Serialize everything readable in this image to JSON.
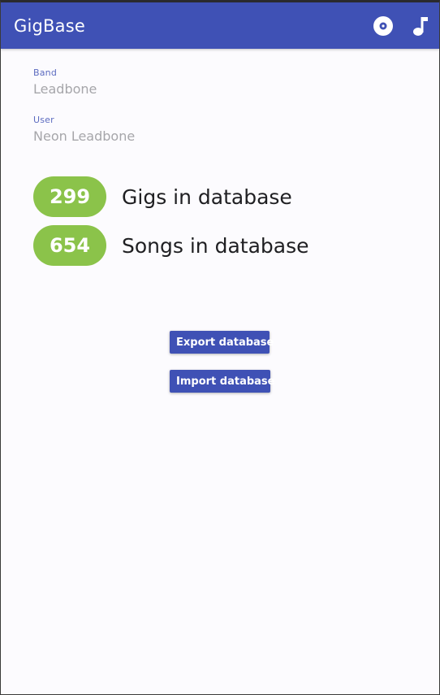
{
  "app": {
    "title": "GigBase"
  },
  "toolbar": {
    "actions": [
      {
        "icon": "disc-icon"
      },
      {
        "icon": "music-note-icon"
      }
    ]
  },
  "fields": {
    "band": {
      "label": "Band",
      "value": "Leadbone"
    },
    "user": {
      "label": "User",
      "value": "Neon Leadbone"
    }
  },
  "stats": {
    "gigs": {
      "count": "299",
      "label": "Gigs in database"
    },
    "songs": {
      "count": "654",
      "label": "Songs in database"
    }
  },
  "buttons": {
    "export_label": "Export database",
    "import_label": "Import database"
  },
  "colors": {
    "primary": "#3f51b5",
    "accent_green": "#8bc34a",
    "background": "#fcfbfe",
    "label_blue": "#5c6bc0"
  }
}
